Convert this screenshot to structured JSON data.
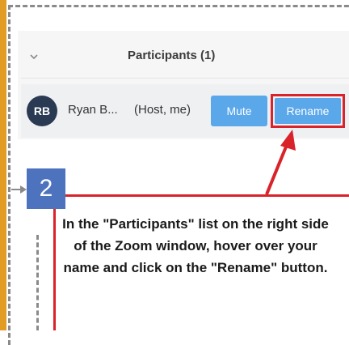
{
  "panel": {
    "title": "Participants (1)",
    "collapse_icon": "chevron-down-icon"
  },
  "participant": {
    "initials": "RB",
    "name": "Ryan B...",
    "role": "(Host, me)",
    "mute_label": "Mute",
    "rename_label": "Rename"
  },
  "annotation": {
    "step_number": "2",
    "text": "In the \"Participants\" list on the right side of the Zoom window, hover over your name and click on the \"Rename\" button."
  },
  "colors": {
    "accent_orange": "#e39c23",
    "button_blue": "#5aa7ea",
    "step_badge_blue": "#4d73be",
    "highlight_red": "#d9222a",
    "avatar_navy": "#2a3a52"
  }
}
